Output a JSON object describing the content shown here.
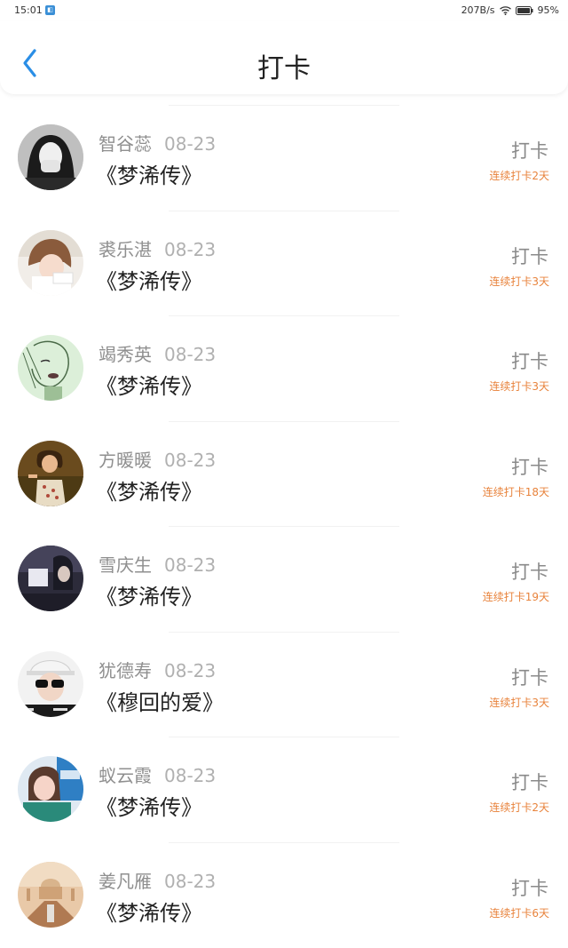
{
  "status_bar": {
    "time": "15:01",
    "app_icon": "app-notification-icon",
    "net_speed": "207B/s",
    "battery": "95%",
    "icons": [
      "wifi-icon",
      "battery-icon"
    ]
  },
  "header": {
    "back_icon": "chevron-left-icon",
    "title": "打卡"
  },
  "colors": {
    "accent_blue": "#2a8ee6",
    "streak_orange": "#e8833c",
    "muted_gray": "#9a9a9a"
  },
  "items": [
    {
      "name": "智谷蕊",
      "date": "08-23",
      "book": "《梦浠传》",
      "action": "打卡",
      "streak": "连续打卡2天",
      "avatar": "avatar-photo"
    },
    {
      "name": "裘乐湛",
      "date": "08-23",
      "book": "《梦浠传》",
      "action": "打卡",
      "streak": "连续打卡3天",
      "avatar": "avatar-photo"
    },
    {
      "name": "竭秀英",
      "date": "08-23",
      "book": "《梦浠传》",
      "action": "打卡",
      "streak": "连续打卡3天",
      "avatar": "avatar-photo"
    },
    {
      "name": "方暖暖",
      "date": "08-23",
      "book": "《梦浠传》",
      "action": "打卡",
      "streak": "连续打卡18天",
      "avatar": "avatar-photo"
    },
    {
      "name": "雪庆生",
      "date": "08-23",
      "book": "《梦浠传》",
      "action": "打卡",
      "streak": "连续打卡19天",
      "avatar": "avatar-photo"
    },
    {
      "name": "犹德寿",
      "date": "08-23",
      "book": "《穆回的爱》",
      "action": "打卡",
      "streak": "连续打卡3天",
      "avatar": "avatar-photo"
    },
    {
      "name": "蚁云霞",
      "date": "08-23",
      "book": "《梦浠传》",
      "action": "打卡",
      "streak": "连续打卡2天",
      "avatar": "avatar-photo"
    },
    {
      "name": "姜凡雁",
      "date": "08-23",
      "book": "《梦浠传》",
      "action": "打卡",
      "streak": "连续打卡6天",
      "avatar": "avatar-photo"
    }
  ]
}
